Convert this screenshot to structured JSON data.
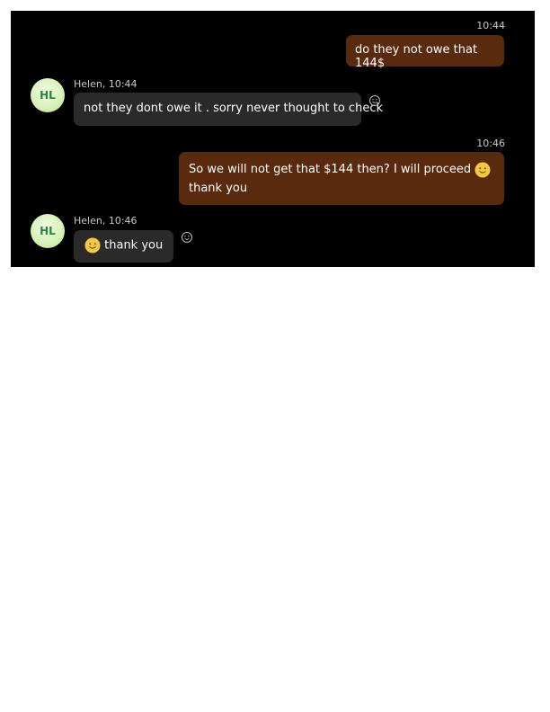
{
  "messages": [
    {
      "direction": "outgoing",
      "time": "10:44",
      "text": "do they not owe that 144$"
    },
    {
      "direction": "incoming",
      "sender_line": "Helen, 10:44",
      "avatar_initials": "HL",
      "text": "not they dont owe it . sorry never thought to check"
    },
    {
      "direction": "outgoing",
      "time": "10:46",
      "line1": "So we will not get that $144 then?  I will proceed",
      "line2": "thank you"
    },
    {
      "direction": "incoming",
      "sender_line": "Helen, 10:46",
      "avatar_initials": "HL",
      "text": "thank you",
      "emoji": "slightly-smiling-face"
    }
  ],
  "colors": {
    "background": "#000000",
    "outgoing_bubble": "#5a2a0e",
    "incoming_bubble": "#2a2a2a",
    "avatar_text": "#1f8a3a"
  },
  "icons": [
    "emoji-reaction-icon",
    "slightly-smiling-face-emoji"
  ]
}
